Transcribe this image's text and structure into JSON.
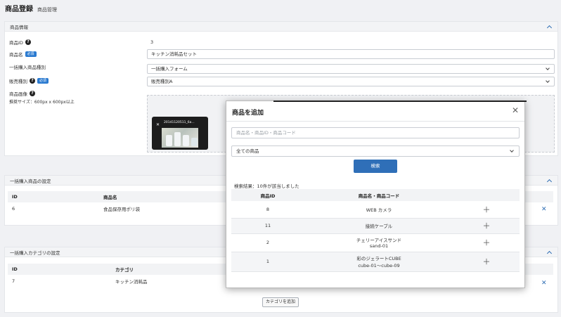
{
  "header": {
    "title": "商品登録",
    "subtitle": "商品管理"
  },
  "product_info": {
    "section_title": "商品情報",
    "id_label": "商品ID",
    "id_value": "3",
    "name_label": "商品名",
    "name_required": "必須",
    "name_value": "キッチン消耗品セット",
    "bulk_type_label": "一括購入商品種別",
    "bulk_type_value": "一括購入フォーム",
    "sale_type_label": "販売種別",
    "sale_type_required": "必須",
    "sale_type_value": "販売種別A",
    "image_label": "商品画像",
    "image_note": "推奨サイズ：600px x 600px以上",
    "image_filename": "20141120511_6a..."
  },
  "bulk_products": {
    "section_title": "一括購入商品の設定",
    "columns": [
      "ID",
      "商品名"
    ],
    "rows": [
      {
        "id": "6",
        "name": "食品保存用ポリ袋"
      }
    ]
  },
  "bulk_categories": {
    "section_title": "一括購入カテゴリの設定",
    "columns": [
      "ID",
      "カテゴリ"
    ],
    "rows": [
      {
        "id": "7",
        "name": "キッチン消耗品"
      }
    ],
    "add_button": "カテゴリを追加"
  },
  "modal": {
    "title": "商品を追加",
    "search_placeholder": "商品名・商品ID・商品コード",
    "category_value": "全ての商品",
    "search_button": "検索",
    "result_count": "検索結果：10件が該当しました",
    "columns": [
      "商品ID",
      "商品名・商品コード"
    ],
    "rows": [
      {
        "id": "8",
        "name": "WEB カメラ",
        "code": ""
      },
      {
        "id": "11",
        "name": "接続ケーブル",
        "code": ""
      },
      {
        "id": "2",
        "name": "チェリーアイスサンド",
        "code": "sand-01"
      },
      {
        "id": "1",
        "name": "彩のジェラートCUBE",
        "code": "cube-01～cube-09"
      }
    ]
  },
  "colors": {
    "accent": "#2f6fb8",
    "required_badge": "#2a7ad0"
  },
  "icons": {
    "close": "close-icon",
    "add": "plus-icon",
    "collapse": "chevron-up-icon",
    "help": "help-icon",
    "delete": "delete-icon"
  }
}
